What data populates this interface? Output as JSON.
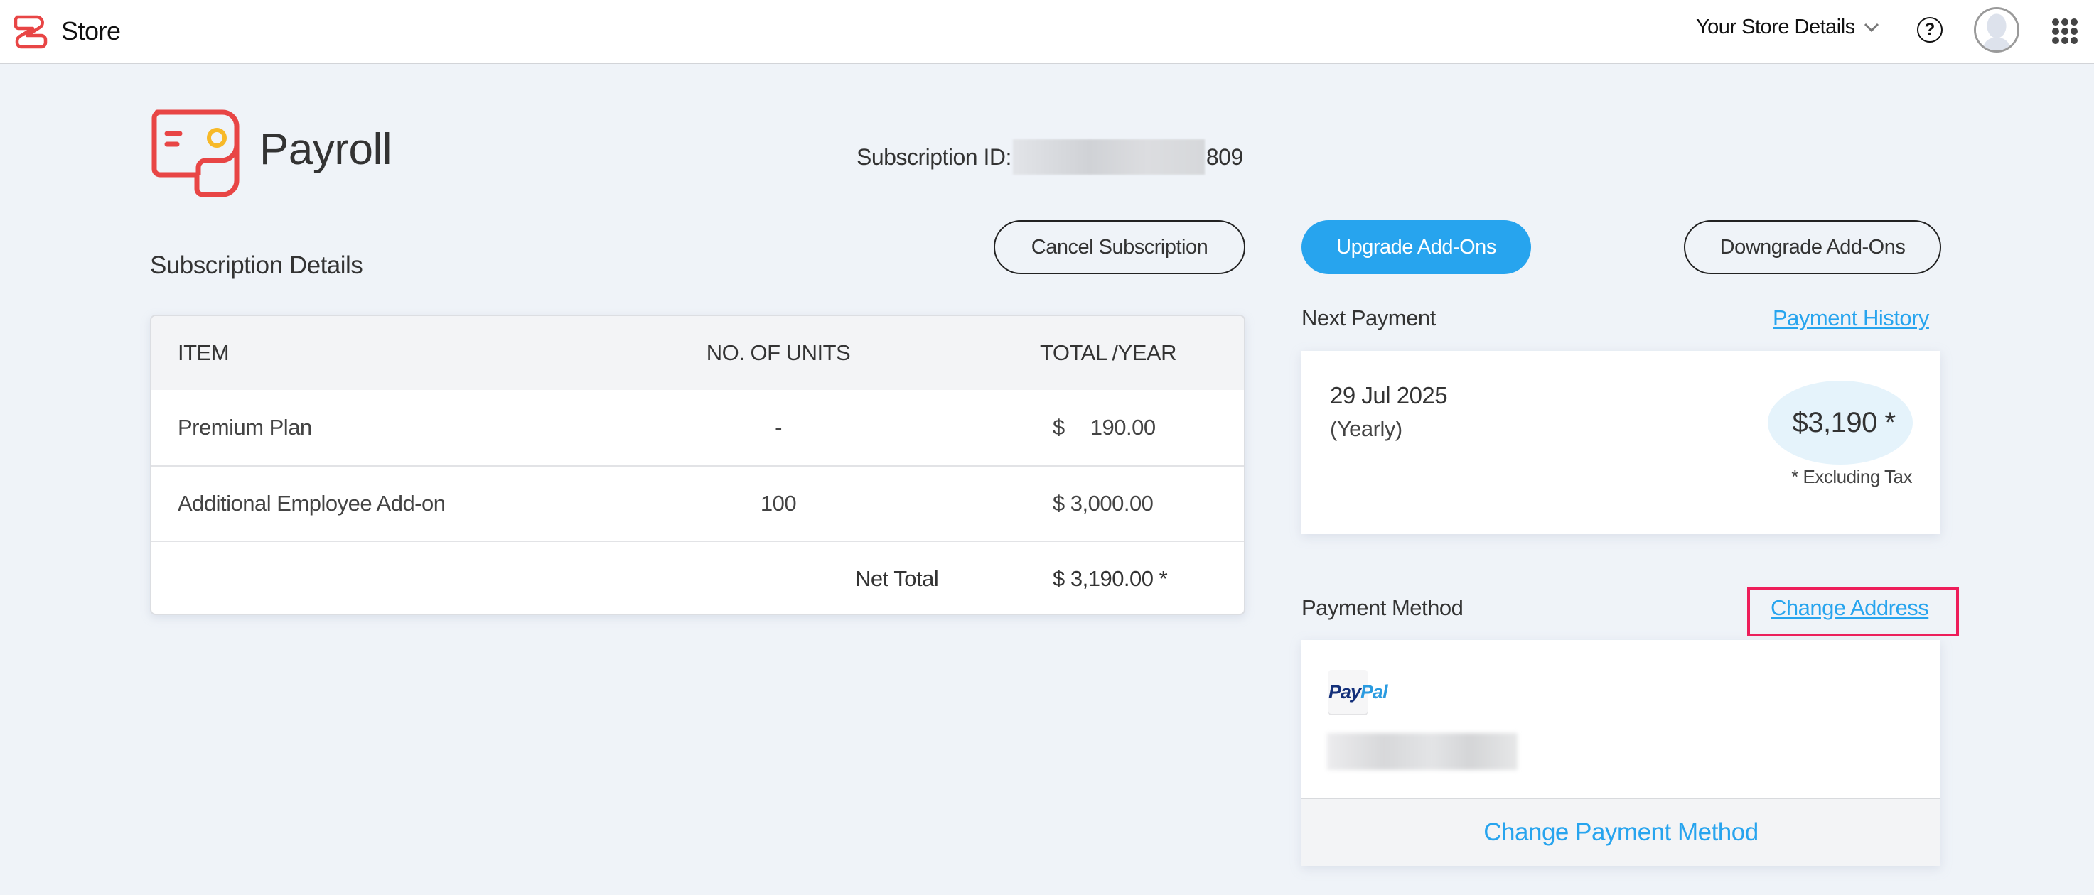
{
  "header": {
    "app_name": "Store",
    "store_details_label": "Your Store Details",
    "help_icon": "?"
  },
  "product": {
    "name": "Payroll",
    "subscription_id_label": "Subscription ID:",
    "subscription_id_visible_suffix": "809"
  },
  "actions": {
    "cancel_label": "Cancel Subscription",
    "upgrade_label": "Upgrade Add-Ons",
    "downgrade_label": "Downgrade Add-Ons"
  },
  "subscription_details": {
    "title": "Subscription Details",
    "columns": [
      "ITEM",
      "NO. OF UNITS",
      "TOTAL /YEAR"
    ],
    "rows": [
      {
        "item": "Premium Plan",
        "units": "-",
        "currency": "$",
        "amount": "190.00"
      },
      {
        "item": "Additional Employee Add-on",
        "units": "100",
        "currency": "$",
        "amount": "3,000.00"
      }
    ],
    "net_total_label": "Net Total",
    "net_total_value": "$ 3,190.00 *"
  },
  "next_payment": {
    "title": "Next Payment",
    "history_link": "Payment History",
    "date": "29 Jul 2025",
    "period": "(Yearly)",
    "amount": "$3,190 *",
    "tax_note": "* Excluding Tax"
  },
  "payment_method": {
    "title": "Payment Method",
    "change_address_link": "Change Address",
    "provider_pay": "Pay",
    "provider_pal": "Pal",
    "change_method_label": "Change Payment Method"
  },
  "colors": {
    "accent": "#27a4ee",
    "brand_red": "#e84545",
    "brand_yellow": "#f7b928",
    "highlight": "#ee1d5a",
    "background": "#eff3f8"
  }
}
